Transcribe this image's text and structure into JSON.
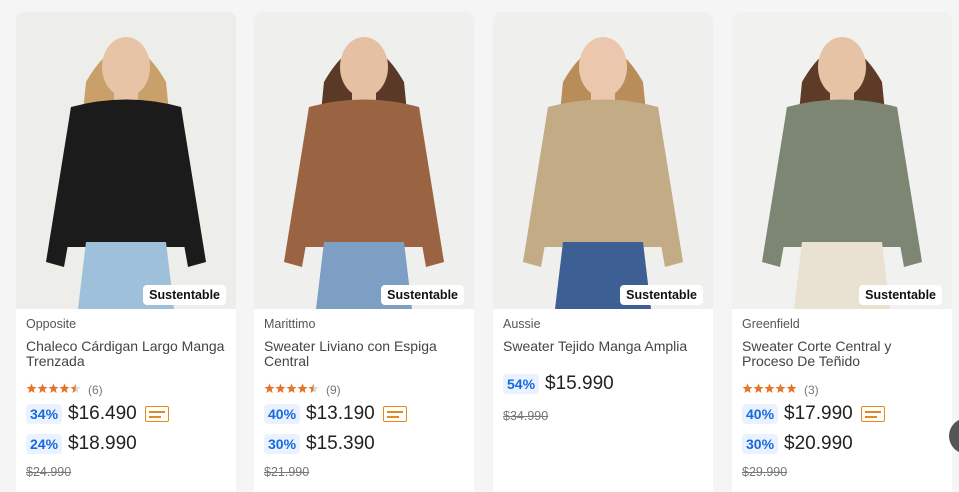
{
  "products": [
    {
      "brand": "Opposite",
      "title": "Chaleco Cárdigan Largo Manga Trenzada",
      "badge": "Sustentable",
      "reviews": "(6)",
      "stars": 4.5,
      "prices": [
        {
          "discount": "34%",
          "amount": "$16.490",
          "card": true
        },
        {
          "discount": "24%",
          "amount": "$18.990",
          "card": false
        }
      ],
      "old_price": "$24.990",
      "colors": {
        "bg": "#ededea",
        "garment": "#1b1b1b",
        "pants": "#9ec0da",
        "hair": "#c9a06a",
        "skin": "#e8c4a6"
      }
    },
    {
      "brand": "Marittimo",
      "title": "Sweater Liviano con Espiga Central",
      "badge": "Sustentable",
      "reviews": "(9)",
      "stars": 4.5,
      "prices": [
        {
          "discount": "40%",
          "amount": "$13.190",
          "card": true
        },
        {
          "discount": "30%",
          "amount": "$15.390",
          "card": false
        }
      ],
      "old_price": "$21.990",
      "colors": {
        "bg": "#efefee",
        "garment": "#9a6443",
        "pants": "#7d9fc4",
        "hair": "#5a3a26",
        "skin": "#e6c0a2"
      }
    },
    {
      "brand": "Aussie",
      "title": "Sweater Tejido Manga Amplia",
      "badge": "Sustentable",
      "reviews": "",
      "stars": 0,
      "prices": [
        {
          "discount": "54%",
          "amount": "$15.990",
          "card": false
        }
      ],
      "old_price": "$34.990",
      "colors": {
        "bg": "#efefee",
        "garment": "#c3ab86",
        "pants": "#3e5f94",
        "hair": "#b88d5a",
        "skin": "#ebc8ad"
      }
    },
    {
      "brand": "Greenfield",
      "title": "Sweater Corte Central y Proceso De Teñido",
      "badge": "Sustentable",
      "reviews": "(3)",
      "stars": 5,
      "prices": [
        {
          "discount": "40%",
          "amount": "$17.990",
          "card": true
        },
        {
          "discount": "30%",
          "amount": "$20.990",
          "card": false
        }
      ],
      "old_price": "$29.990",
      "colors": {
        "bg": "#f1f1ef",
        "garment": "#7c8673",
        "pants": "#e9e2d3",
        "hair": "#5d3b27",
        "skin": "#e7c3a6"
      }
    }
  ],
  "ui": {
    "star_color": "#e8742a",
    "star_empty": "#d9d9d9",
    "discount_color": "#1769e0"
  }
}
